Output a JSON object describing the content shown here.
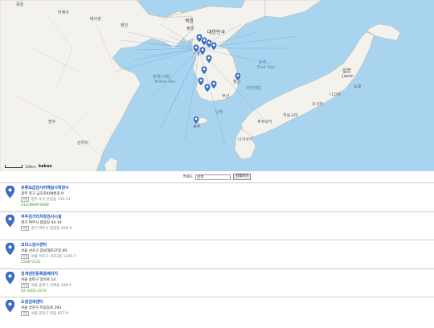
{
  "map": {
    "labels": {
      "mongolia_area": "몽골",
      "hebei": "허베이",
      "tianjin": "톈진",
      "beijing": "베이징",
      "north_korea": "북한",
      "pyongyang": "평양",
      "seoul": "서울",
      "south_korea": "대한민국",
      "yellow_sea": "황해(서해)",
      "yellow_sea_en": "Yellow Sea",
      "east_sea": "동해",
      "east_sea_en": "East Sea",
      "korea_strait": "대한해협",
      "south_sea": "남해",
      "japan": "일본",
      "japan_en": "Japan",
      "jiangsu": "장쑤",
      "shanghai": "상하이",
      "busan": "부산",
      "jeju": "제주",
      "ulsan": "울산",
      "nagasaki": "나가사키",
      "fukuoka": "후쿠오카",
      "osaka": "오사카",
      "hiroshima": "히로시마",
      "nagoya": "나고야",
      "tokyo": "도쿄"
    },
    "scale_text": "128km",
    "logo": "kakao"
  },
  "search": {
    "label": "키워드",
    "value": "검색",
    "button": "검색하기"
  },
  "results": [
    {
      "name": "유류보급검사피해실사학원수",
      "address": "광주 북구 금호로409번길 9",
      "jibun_tag": "지번",
      "jibun": "광주 북구 운암동 115-11",
      "phone": "010-8809-9068"
    },
    {
      "name": "여주검거리차량검사시설",
      "address": "경기 여주시 점봉길 44-19",
      "jibun_tag": "지번",
      "jibun": "경기 여주시 점봉동 204-3",
      "phone": ""
    },
    {
      "name": "코리스검사센터",
      "address": "서울 서초구 강남대로37길 49",
      "jibun_tag": "지번",
      "jibun": "서울 서초구 서초2동 1345-7",
      "phone": "1566-5531"
    },
    {
      "name": "검색엔진등록홈페이지",
      "address": "서울 송파구 양산로 14",
      "jibun_tag": "지번",
      "jibun": "서울 송파구 거여동 286-1",
      "phone": "02-3402-3276"
    },
    {
      "name": "도청검색센터",
      "address": "서울 양천구 목동동로 293",
      "jibun_tag": "지번",
      "jibun": "서울 양천구 목동 917-9",
      "phone": ""
    }
  ],
  "colors": {
    "sea": "#a8d4ef",
    "land": "#f4f2ec",
    "marker": "#3f6fc4",
    "link": "#1a56c9",
    "phone": "#3a9a2a"
  },
  "icons": {
    "marker": "map-pin-icon"
  }
}
